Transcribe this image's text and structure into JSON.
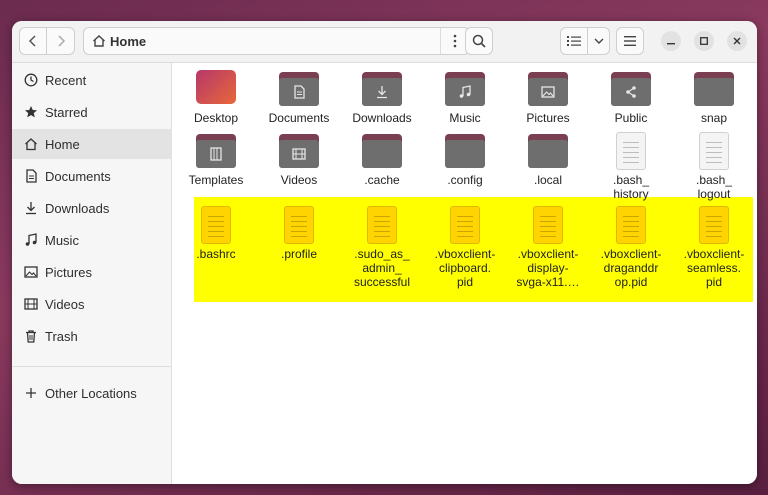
{
  "window": {
    "title": "Home"
  },
  "header": {
    "pathbar_label": "Home"
  },
  "sidebar": {
    "items": [
      {
        "label": "Recent",
        "icon": "clock-icon"
      },
      {
        "label": "Starred",
        "icon": "star-icon"
      },
      {
        "label": "Home",
        "icon": "home-icon",
        "active": true
      },
      {
        "label": "Documents",
        "icon": "document-icon"
      },
      {
        "label": "Downloads",
        "icon": "download-icon"
      },
      {
        "label": "Music",
        "icon": "music-icon"
      },
      {
        "label": "Pictures",
        "icon": "picture-icon"
      },
      {
        "label": "Videos",
        "icon": "video-icon"
      },
      {
        "label": "Trash",
        "icon": "trash-icon"
      },
      {
        "label": "Other Locations",
        "icon": "plus-icon"
      }
    ]
  },
  "files": [
    {
      "name": "Desktop",
      "type": "desktop-folder"
    },
    {
      "name": "Documents",
      "type": "folder",
      "glyph": "document"
    },
    {
      "name": "Downloads",
      "type": "folder",
      "glyph": "download"
    },
    {
      "name": "Music",
      "type": "folder",
      "glyph": "music"
    },
    {
      "name": "Pictures",
      "type": "folder",
      "glyph": "picture"
    },
    {
      "name": "Public",
      "type": "folder",
      "glyph": "share"
    },
    {
      "name": "snap",
      "type": "folder"
    },
    {
      "name": "Templates",
      "type": "folder",
      "glyph": "template"
    },
    {
      "name": "Videos",
      "type": "folder",
      "glyph": "video"
    },
    {
      "name": ".cache",
      "type": "folder"
    },
    {
      "name": ".config",
      "type": "folder"
    },
    {
      "name": ".local",
      "type": "folder"
    },
    {
      "name": ".bash_\nhistory",
      "type": "text-file"
    },
    {
      "name": ".bash_\nlogout",
      "type": "text-file"
    },
    {
      "name": ".bashrc",
      "type": "text-file",
      "highlight": true
    },
    {
      "name": ".profile",
      "type": "text-file",
      "highlight": true
    },
    {
      "name": ".sudo_as_\nadmin_\nsuccessful",
      "type": "text-file",
      "highlight": true
    },
    {
      "name": ".vboxclient-\nclipboard.\npid",
      "type": "text-file",
      "highlight": true
    },
    {
      "name": ".vboxclient-\ndisplay-\nsvga-x11.…",
      "type": "text-file",
      "highlight": true
    },
    {
      "name": ".vboxclient-\ndraganddr\nop.pid",
      "type": "text-file",
      "highlight": true
    },
    {
      "name": ".vboxclient-\nseamless.\npid",
      "type": "text-file",
      "highlight": true
    }
  ],
  "colors": {
    "highlight": "#ffff00",
    "folder_tab": "#7b3f52",
    "folder_body": "#6e6e6e",
    "desktop_gradient_start": "#b6386a",
    "desktop_gradient_end": "#e8673a"
  }
}
